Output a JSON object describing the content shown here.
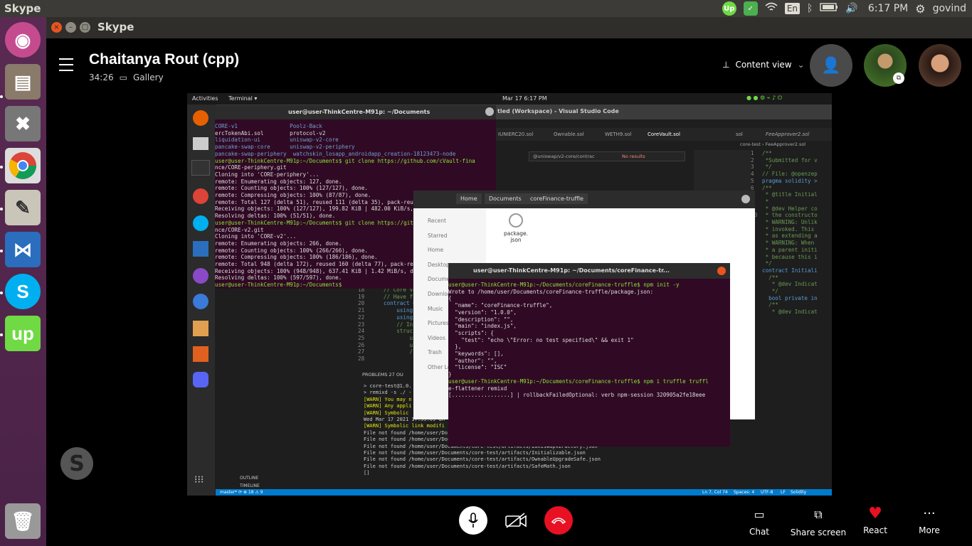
{
  "system": {
    "app_name": "Skype",
    "time": "6:17 PM",
    "user": "govind",
    "lang": "En",
    "upwork_badge": "Up"
  },
  "window": {
    "title": "Skype"
  },
  "call": {
    "name": "Chaitanya Rout (cpp)",
    "duration": "34:26",
    "view_mode": "Gallery",
    "content_view": "Content view"
  },
  "controls": {
    "chat": "Chat",
    "share_screen": "Share screen",
    "react": "React",
    "more": "More"
  },
  "shared": {
    "gnome": {
      "activities": "Activities",
      "app": "Terminal ▾",
      "clock": "Mar 17  6:17 PM"
    },
    "terminal1": {
      "title": "user@user-ThinkCentre-M91p: ~/Documents",
      "lines": [
        "CORE-v1                Poolz-Back",
        "ercTokenAbi.sol        protocol-v2",
        "liquidation-ui         uniswap-v2-core",
        "pancake-swap-core      uniswap-v2-periphery",
        "pancake-swap-periphery  watchskin_losapp_androidapp_creation-18123473-node",
        "user@user-ThinkCentre-M91p:~/Documents$ git clone https://github.com/cVault-fina",
        "nce/CORE-periphery.git",
        "Cloning into 'CORE-periphery'...",
        "remote: Enumerating objects: 127, done.",
        "remote: Counting objects: 100% (127/127), done.",
        "remote: Compressing objects: 100% (87/87), done.",
        "remote: Total 127 (delta 51), reused 111 (delta 35), pack-reused 0",
        "Receiving objects: 100% (127/127), 199.82 KiB | 482.00 KiB/s, done.",
        "Resolving deltas: 100% (51/51), done.",
        "user@user-ThinkCentre-M91p:~/Documents$ git clone https://github.com/cVault-fina",
        "nce/CORE-v2.git",
        "Cloning into 'CORE-v2'...",
        "remote: Enumerating objects: 266, done.",
        "remote: Counting objects: 100% (266/266), done.",
        "remote: Compressing objects: 100% (186/186), done.",
        "remote: Total 948 (delta 172), reused 160 (delta 77), pack-reused 682",
        "Receiving objects: 100% (948/948), 637.41 KiB | 1.42 MiB/s, done.",
        "Resolving deltas: 100% (597/597), done.",
        "user@user-ThinkCentre-M91p:~/Documents$ "
      ]
    },
    "vscode": {
      "title": "tled (Workspace) - Visual Studio Code",
      "tabs": [
        "IUNIERC20.sol",
        "Ownable.sol",
        "WETH9.sol",
        "CoreVault.sol",
        "sol",
        "FeeApprover2.sol"
      ],
      "find": "@uniswap/v2-core/contrac",
      "find_result": "No results",
      "breadcrumb": "core-test › FeeApprover2.sol",
      "code": [
        "/**",
        " *Submitted for v",
        " */",
        "",
        "// File: @openzep",
        "",
        "pragma solidity >",
        "",
        "",
        "/**",
        " * @title Initial",
        " *",
        " * @dev Helper co",
        " * the constructo",
        " * WARNING: Unlik",
        " * invoked. This ",
        " * as extending a",
        " * WARNING: When ",
        " * a parent initi",
        " * because this i",
        " */",
        "contract Initiali",
        "",
        "  /**",
        "   * @dev Indicat",
        "   */",
        "  bool private in",
        "",
        "  /**",
        "   * @dev Indicat"
      ],
      "left_code": [
        "// Core va",
        "// Have f",
        "contract C",
        "    using",
        "    using",
        "",
        "    // In",
        "    struc",
        "        u",
        "        u",
        "        /"
      ],
      "left_lines": [
        "18",
        "19",
        "20",
        "21",
        "22",
        "23",
        "24",
        "25",
        "26",
        "27",
        "28"
      ],
      "panel_tabs": "PROBLEMS  27  OU",
      "terminal": [
        "> core-test@1.0.",
        "> remixd -s ./ -",
        "",
        "[WARN] You may n",
        "[WARN] Any appli",
        "[WARN] Symbolic ",
        "",
        "Wed Mar 17 2021 17:59:09 GM",
        "[WARN] Symbolic link modifi",
        "File not found /home/user/Do",
        "File not found /home/user/Documents/core-test/artifacts/IERC20.json",
        "File not found /home/user/Documents/core-test/artifacts/IUniswapV2Factory.json",
        "File not found /home/user/Documents/core-test/artifacts/Initializable.json",
        "File not found /home/user/Documents/core-test/artifacts/OwnableUpgradeSafe.json",
        "File not found /home/user/Documents/core-test/artifacts/SafeMath.json",
        "[]"
      ],
      "status_left": "master*   ⟳   ⊗ 18 ⚠ 9",
      "status_right": [
        "Ln 7, Col 74",
        "Spaces: 4",
        "UTF-8",
        "LF",
        "Solidity"
      ],
      "outline": "OUTLINE",
      "timeline": "TIMELINE"
    },
    "files": {
      "crumbs": [
        "Home",
        "Documents",
        "coreFinance-truffle"
      ],
      "sidebar": [
        "Recent",
        "Starred",
        "Home",
        "Desktop",
        "Documents",
        "Downloads",
        "Music",
        "Pictures",
        "Videos",
        "Trash",
        "Other Locations"
      ],
      "file": "package.\njson"
    },
    "terminal2": {
      "title": "user@user-ThinkCentre-M91p: ~/Documents/coreFinance-tr...",
      "lines": [
        "user@user-ThinkCentre-M91p:~/Documents/coreFinance-truffle$ npm init -y",
        "Wrote to /home/user/Documents/coreFinance-truffle/package.json:",
        "",
        "{",
        "  \"name\": \"coreFinance-truffle\",",
        "  \"version\": \"1.0.0\",",
        "  \"description\": \"\",",
        "  \"main\": \"index.js\",",
        "  \"scripts\": {",
        "    \"test\": \"echo \\\"Error: no test specified\\\" && exit 1\"",
        "  },",
        "  \"keywords\": [],",
        "  \"author\": \"\",",
        "  \"license\": \"ISC\"",
        "}",
        "",
        "",
        "user@user-ThinkCentre-M91p:~/Documents/coreFinance-truffle$ npm i truffle truffl",
        "e-flattener remixd",
        "[..................] | rollbackFailedOptional: verb npm-session 320905a2fe18eee"
      ]
    }
  },
  "colors": {
    "launcher": "#4a2247",
    "topbar": "#3c3b37",
    "terminal_bg": "#300a24",
    "accent_red": "#e81123",
    "upwork": "#6fda44",
    "skype": "#00aff0"
  }
}
